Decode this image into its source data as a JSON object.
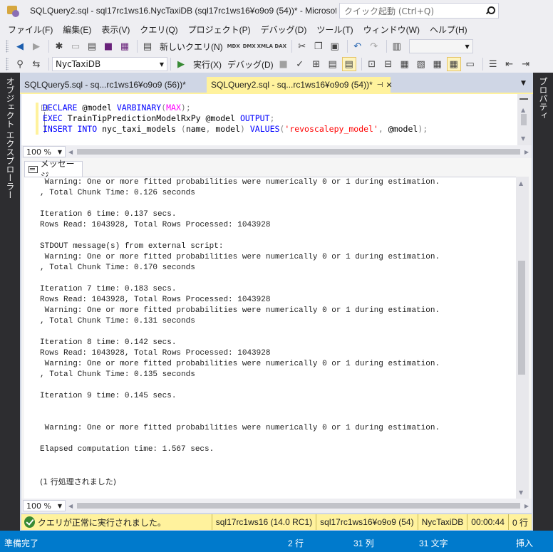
{
  "window": {
    "title": "SQLQuery2.sql - sql17rc1ws16.NycTaxiDB (sql17rc1ws16¥o9o9 (54))* - Microsof...",
    "quick_launch_placeholder": "クイック起動 (Ctrl+Q)"
  },
  "menu": [
    "ファイル(F)",
    "編集(E)",
    "表示(V)",
    "クエリ(Q)",
    "プロジェクト(P)",
    "デバッグ(D)",
    "ツール(T)",
    "ウィンドウ(W)",
    "ヘルプ(H)"
  ],
  "toolbar1": {
    "new_query_label": "新しいクエリ(N)",
    "small_labels": [
      "MDX",
      "DMX",
      "XMLA",
      "DAX"
    ]
  },
  "toolbar2": {
    "database": "NycTaxiDB",
    "execute_label": "実行(X)",
    "debug_label": "デバッグ(D)"
  },
  "side_panels": {
    "left": "オブジェクト エクスプローラー",
    "right": "プロパティ"
  },
  "doc_tabs": [
    {
      "label": "SQLQuery5.sql - sq...rc1ws16¥o9o9 (56))*"
    },
    {
      "label": "SQLQuery2.sql - sq...rc1ws16¥o9o9 (54))*"
    }
  ],
  "editor": {
    "zoom": "100 %"
  },
  "results": {
    "tab_label": "メッセージ",
    "zoom": "100 %",
    "lines": [
      " Warning: One or more fitted probabilities were numerically 0 or 1 during estimation.",
      ", Total Chunk Time: 0.126 seconds",
      "",
      "Iteration 6 time: 0.137 secs.",
      "Rows Read: 1043928, Total Rows Processed: 1043928",
      "",
      "STDOUT message(s) from external script:",
      " Warning: One or more fitted probabilities were numerically 0 or 1 during estimation.",
      ", Total Chunk Time: 0.170 seconds",
      "",
      "Iteration 7 time: 0.183 secs.",
      "Rows Read: 1043928, Total Rows Processed: 1043928",
      " Warning: One or more fitted probabilities were numerically 0 or 1 during estimation.",
      ", Total Chunk Time: 0.131 seconds",
      "",
      "Iteration 8 time: 0.142 secs.",
      "Rows Read: 1043928, Total Rows Processed: 1043928",
      " Warning: One or more fitted probabilities were numerically 0 or 1 during estimation.",
      ", Total Chunk Time: 0.135 seconds",
      "",
      "Iteration 9 time: 0.145 secs.",
      "",
      "",
      "",
      " Warning: One or more fitted probabilities were numerically 0 or 1 during estimation.",
      "",
      "Elapsed computation time: 1.567 secs.",
      "",
      "",
      "",
      "(1 行処理されました)"
    ]
  },
  "query_status": {
    "message": "クエリが正常に実行されました。",
    "server": "sql17rc1ws16 (14.0 RC1)",
    "user": "sql17rc1ws16¥o9o9 (54)",
    "database": "NycTaxiDB",
    "elapsed": "00:00:44",
    "rows": "0 行"
  },
  "statusbar": {
    "ready": "準備完了",
    "line": "2 行",
    "col": "31 列",
    "ch": "31 文字",
    "mode": "挿入"
  }
}
